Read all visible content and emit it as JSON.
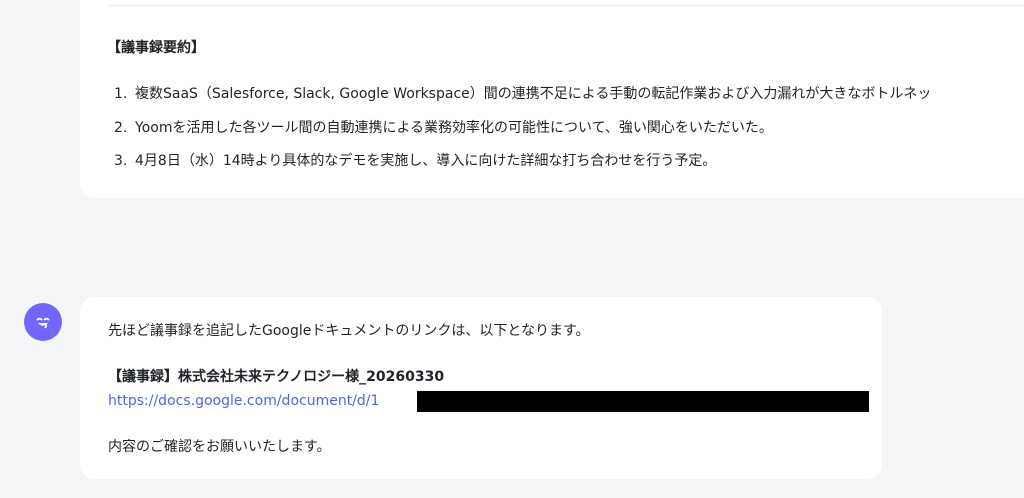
{
  "summary": {
    "heading": "【議事録要約】",
    "items": [
      {
        "num": "1.",
        "text": "複数SaaS（Salesforce, Slack, Google Workspace）間の連携不足による手動の転記作業および入力漏れが大きなボトルネッ"
      },
      {
        "num": "2.",
        "text": "Yoomを活用した各ツール間の自動連携による業務効率化の可能性について、強い関心をいただいた。"
      },
      {
        "num": "3.",
        "text": "4月8日（水）14時より具体的なデモを実施し、導入に向けた詳細な打ち合わせを行う予定。"
      }
    ]
  },
  "message": {
    "avatar_icon": "bot-face-icon",
    "intro": "先ほど議事録を追記したGoogleドキュメントのリンクは、以下となります。",
    "doc_title": "【議事録】株式会社未来テクノロジー様_20260330",
    "doc_link": "https://docs.google.com/document/d/1",
    "outro": "内容のご確認をお願いいたします。"
  },
  "colors": {
    "background": "#f4f5f7",
    "card": "#ffffff",
    "avatar": "#7366ff",
    "link": "#5464e0",
    "redaction": "#000000"
  }
}
